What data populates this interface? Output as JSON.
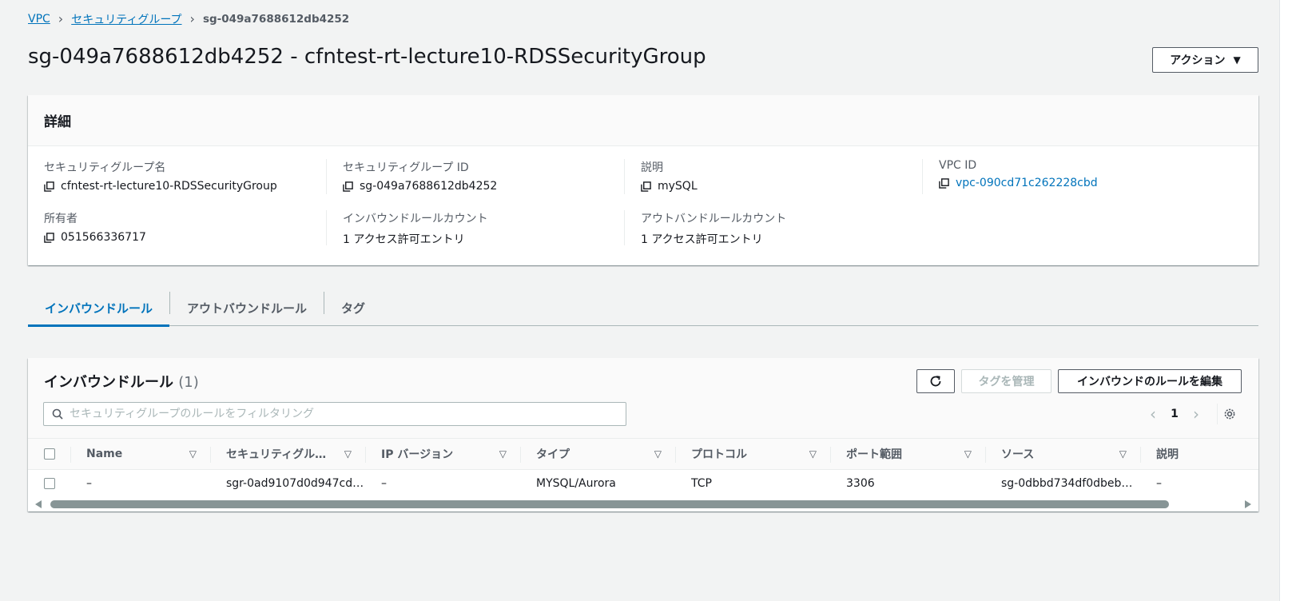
{
  "breadcrumb": {
    "vpc": "VPC",
    "security_groups": "セキュリティグループ",
    "current": "sg-049a7688612db4252"
  },
  "page": {
    "title": "sg-049a7688612db4252 - cfntest-rt-lecture10-RDSSecurityGroup",
    "actions_label": "アクション"
  },
  "details": {
    "header": "詳細",
    "sg_name_label": "セキュリティグループ名",
    "sg_name_value": "cfntest-rt-lecture10-RDSSecurityGroup",
    "sg_id_label": "セキュリティグループ ID",
    "sg_id_value": "sg-049a7688612db4252",
    "description_label": "説明",
    "description_value": "mySQL",
    "vpc_id_label": "VPC ID",
    "vpc_id_value": "vpc-090cd71c262228cbd",
    "owner_label": "所有者",
    "owner_value": "051566336717",
    "inbound_count_label": "インバウンドルールカウント",
    "inbound_count_value": "1 アクセス許可エントリ",
    "outbound_count_label": "アウトバンドルールカウント",
    "outbound_count_value": "1 アクセス許可エントリ"
  },
  "tabs": [
    {
      "label": "インバウンドルール",
      "active": true
    },
    {
      "label": "アウトバウンドルール",
      "active": false
    },
    {
      "label": "タグ",
      "active": false
    }
  ],
  "rules": {
    "title": "インバウンドルール",
    "count": "(1)",
    "manage_tags_label": "タグを管理",
    "edit_rules_label": "インバウンドのルールを編集",
    "filter_placeholder": "セキュリティグループのルールをフィルタリング",
    "page_number": "1",
    "columns": [
      "Name",
      "セキュリティグル…",
      "IP バージョン",
      "タイプ",
      "プロトコル",
      "ポート範囲",
      "ソース",
      "説明"
    ],
    "rows": [
      [
        "–",
        "sgr-0ad9107d0d947cd…",
        "–",
        "MYSQL/Aurora",
        "TCP",
        "3306",
        "sg-0dbbd734df0dbeb…",
        "–"
      ]
    ]
  },
  "colors": {
    "link": "#0073bb",
    "background": "#f2f3f3",
    "header_bg": "#fafafa"
  },
  "icons": {
    "breadcrumb_separator": "chevron-right-icon",
    "copy": "copy-icon",
    "refresh": "refresh-icon",
    "search": "search-icon",
    "settings": "gear-icon",
    "filter": "caret-down-icon"
  }
}
